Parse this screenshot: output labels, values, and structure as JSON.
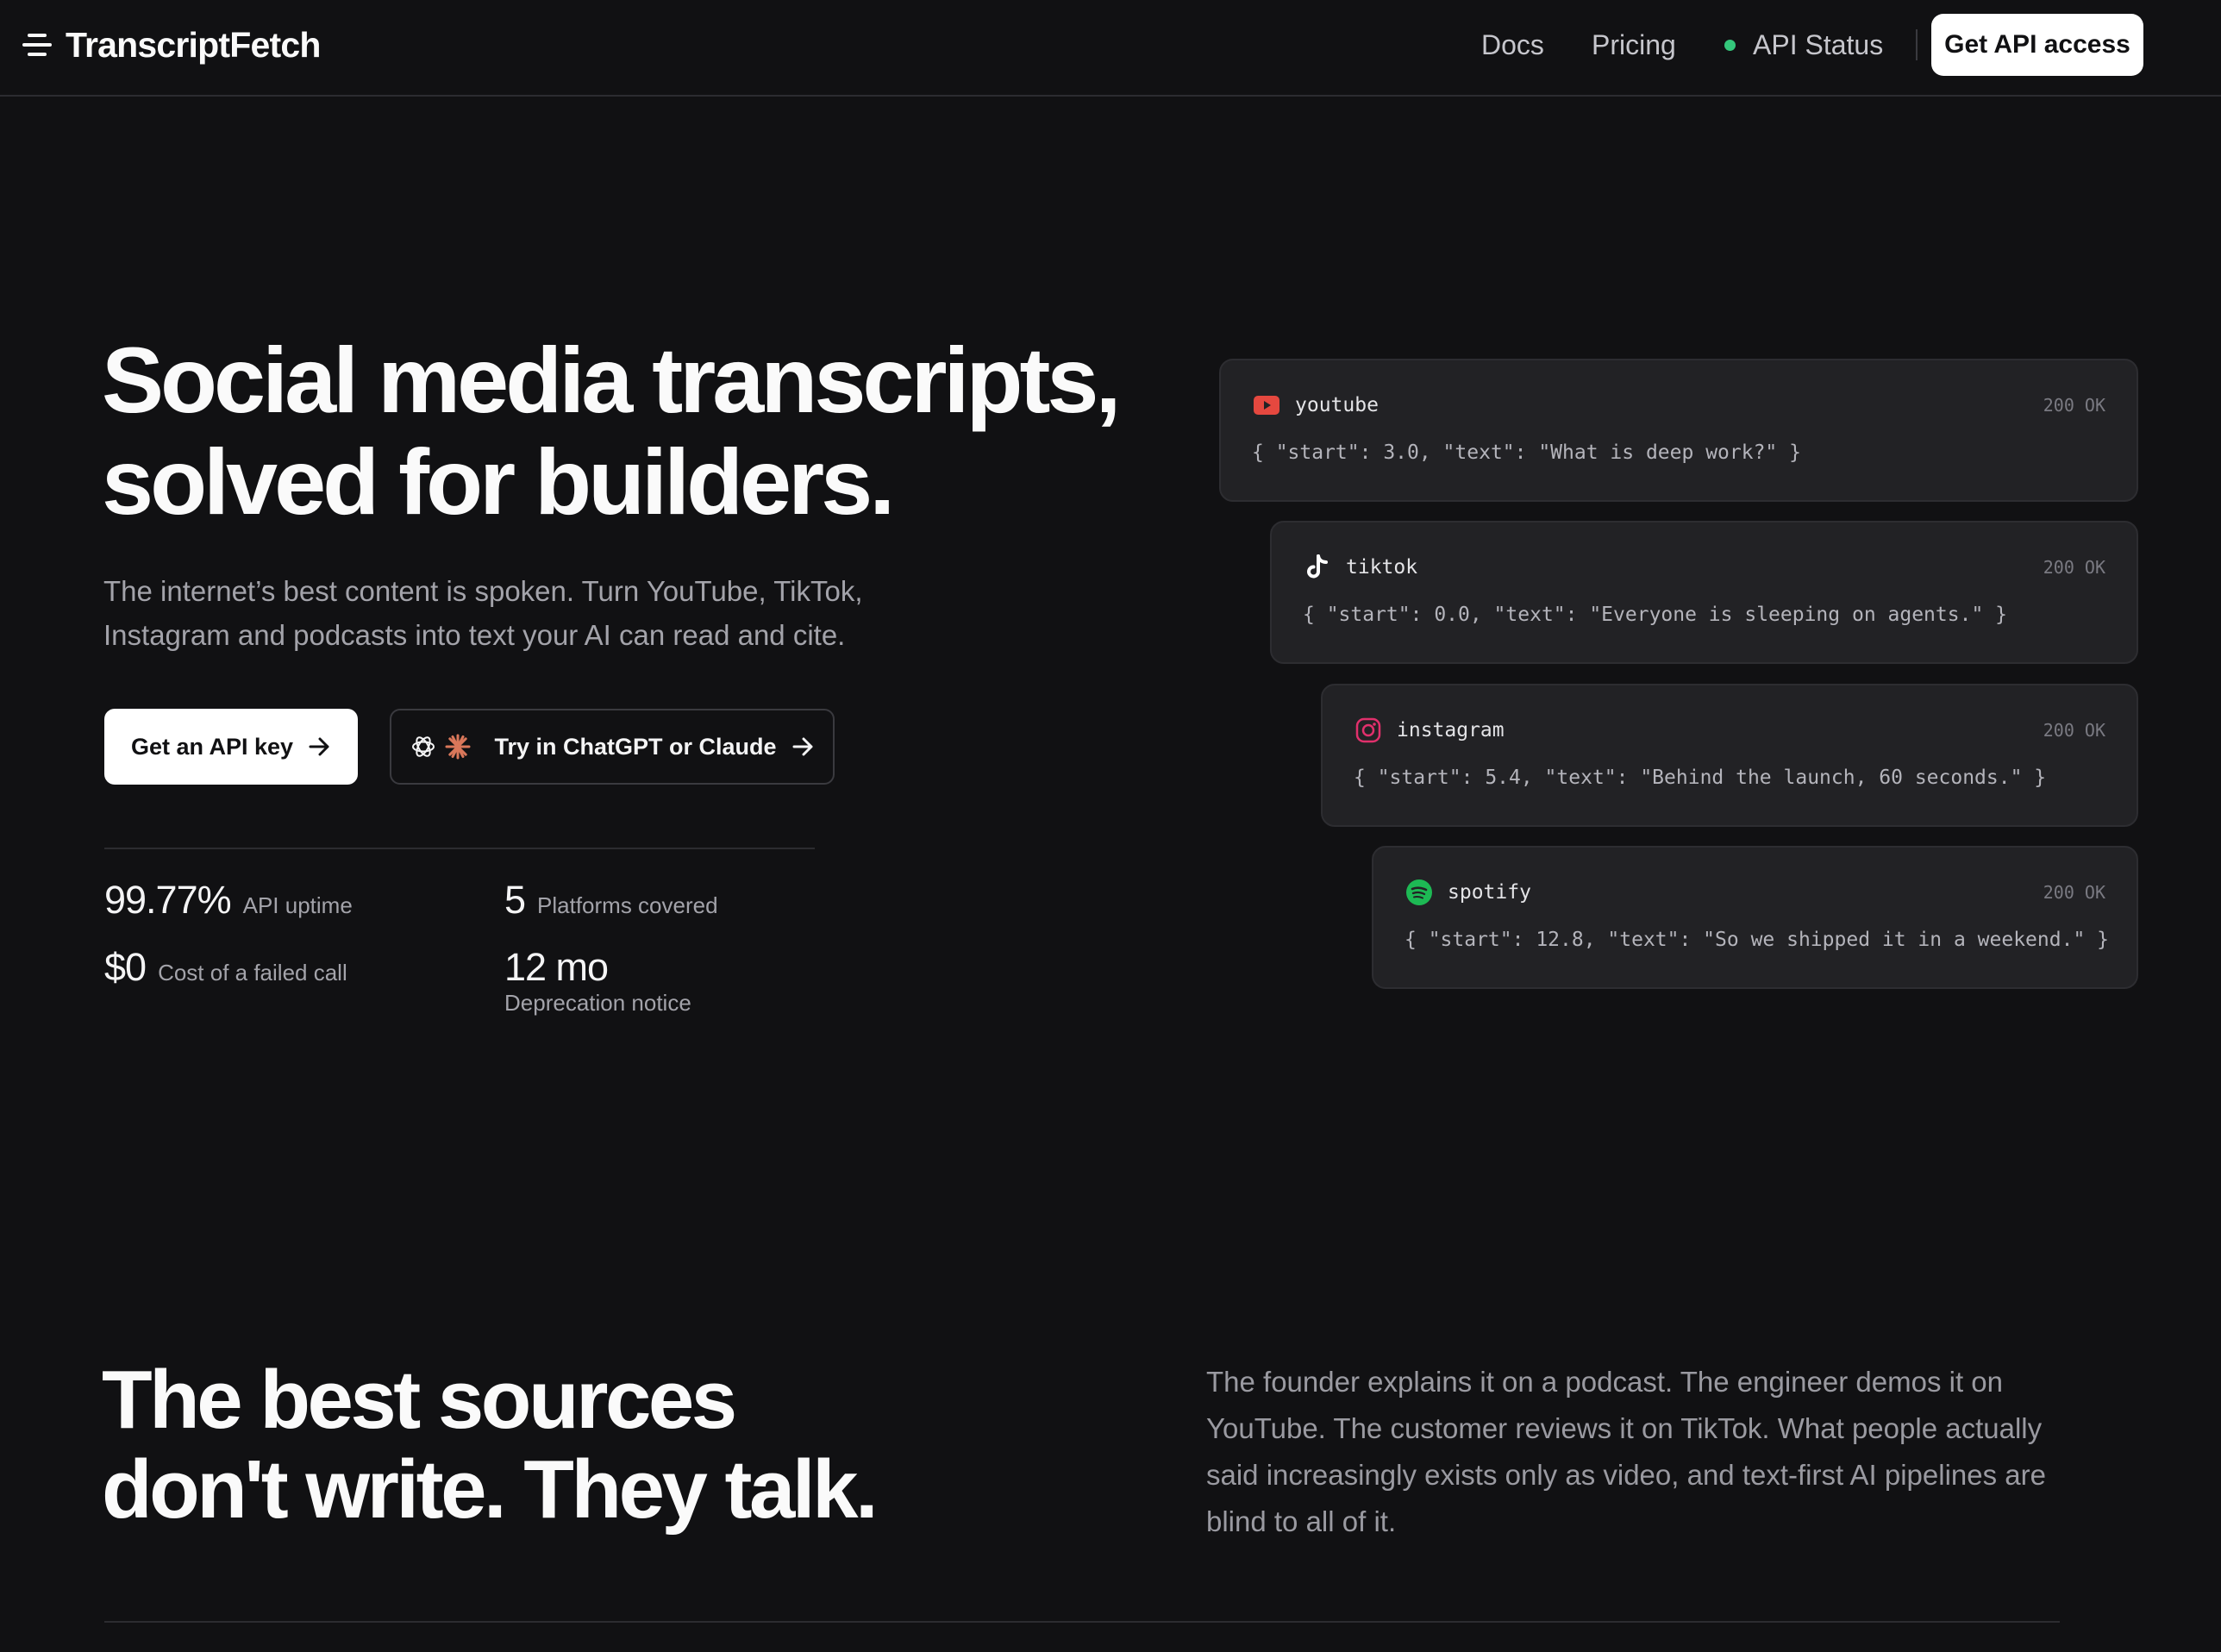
{
  "nav": {
    "brand": "TranscriptFetch",
    "links": {
      "docs": "Docs",
      "pricing": "Pricing",
      "status": "API Status"
    },
    "cta": "Get API access",
    "status_color": "#34c77b"
  },
  "hero": {
    "title_line1": "Social media transcripts,",
    "title_line2": "solved for builders.",
    "subtitle_line1": "The internet’s best content is spoken. Turn YouTube, TikTok,",
    "subtitle_line2": "Instagram and podcasts into text your AI can read and cite.",
    "primary_button": "Get an API key",
    "secondary_button": "Try in ChatGPT or Claude",
    "stats": [
      {
        "value": "99.77%",
        "label": "API uptime"
      },
      {
        "value": "5",
        "label": "Platforms covered"
      },
      {
        "value": "$0",
        "label": "Cost of a failed call"
      },
      {
        "value": "12 mo",
        "label": "Deprecation notice"
      }
    ]
  },
  "responses": [
    {
      "platform": "youtube",
      "status": "200 OK",
      "body": "{ \"start\": 3.0, \"text\": \"What is deep work?\" }",
      "icon": "youtube-icon",
      "color": "#e5483f"
    },
    {
      "platform": "tiktok",
      "status": "200 OK",
      "body": "{ \"start\": 0.0, \"text\": \"Everyone is sleeping on agents.\" }",
      "icon": "tiktok-icon",
      "color": "#ffffff"
    },
    {
      "platform": "instagram",
      "status": "200 OK",
      "body": "{ \"start\": 5.4, \"text\": \"Behind the launch, 60 seconds.\" }",
      "icon": "instagram-icon",
      "color": "#e1306c"
    },
    {
      "platform": "spotify",
      "status": "200 OK",
      "body": "{ \"start\": 12.8, \"text\": \"So we shipped it in a weekend.\" }",
      "icon": "spotify-icon",
      "color": "#1db954"
    }
  ],
  "section2": {
    "title_line1": "The best sources",
    "title_line2": "don't write. They talk.",
    "body": "The founder explains it on a podcast. The engineer demos it on YouTube. The customer reviews it on TikTok. What people actually said increasingly exists only as video, and text-first AI pipelines are blind to all of it."
  }
}
